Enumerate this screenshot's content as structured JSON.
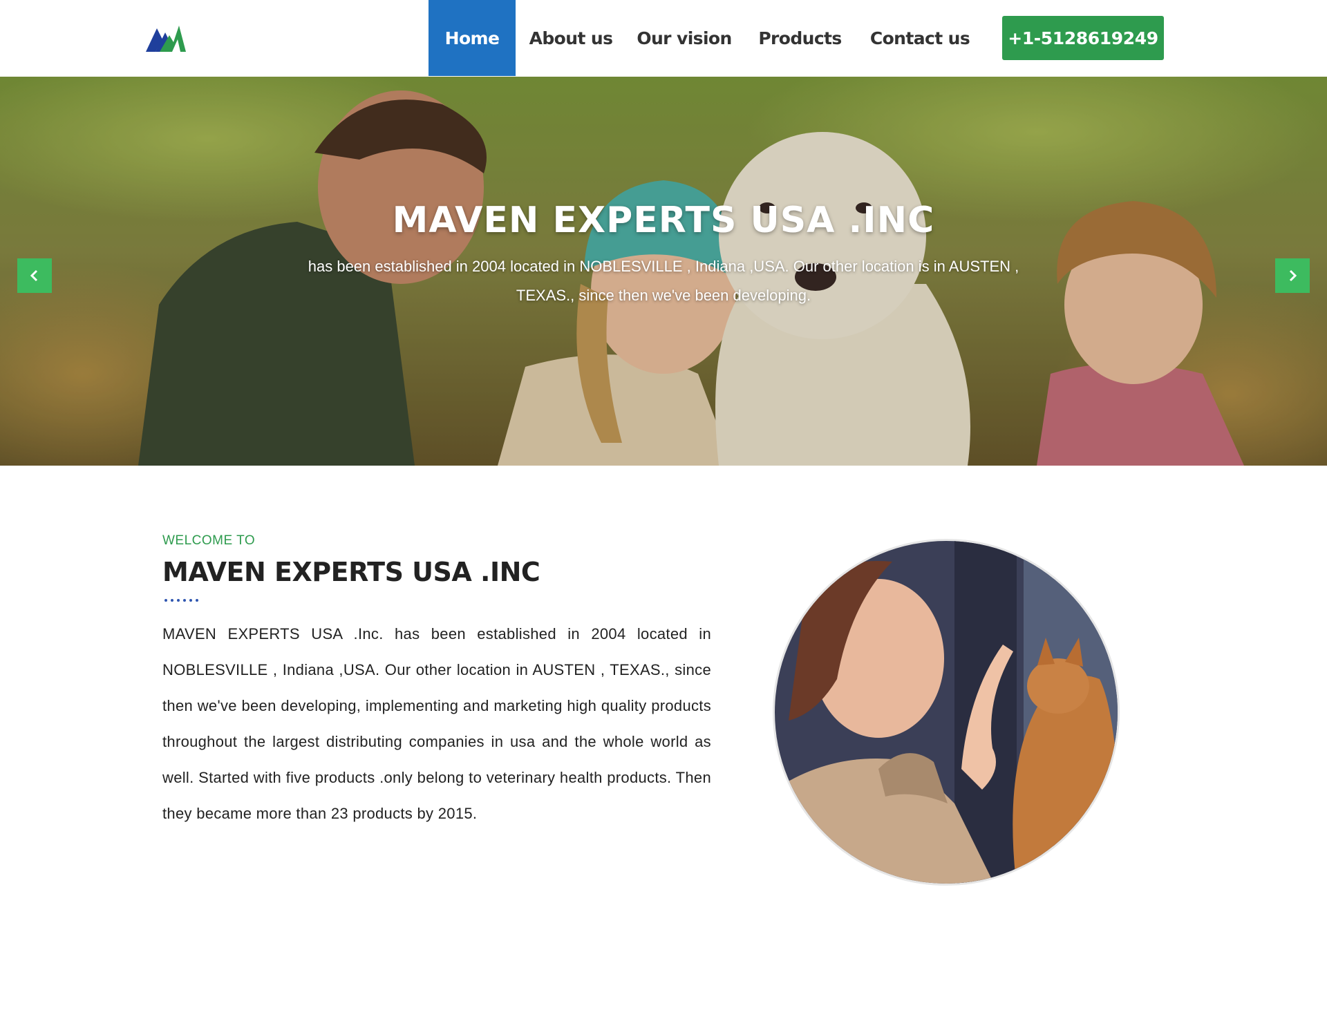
{
  "header": {
    "logo_alt": "Maven Experts logo",
    "nav": [
      {
        "label": "Home",
        "active": true
      },
      {
        "label": "About us",
        "active": false
      },
      {
        "label": "Our vision",
        "active": false
      },
      {
        "label": "Products",
        "active": false
      },
      {
        "label": "Contact us",
        "active": false
      }
    ],
    "phone_label": "+1-5128619249"
  },
  "hero": {
    "title": "MAVEN EXPERTS USA .INC",
    "text": "has been established in 2004 located in NOBLESVILLE , Indiana ,USA. Our other location is in AUSTEN , TEXAS., since then we've been developing.",
    "prev_icon": "chevron-left-icon",
    "next_icon": "chevron-right-icon"
  },
  "welcome": {
    "kicker": "WELCOME TO",
    "title": "MAVEN EXPERTS USA .INC",
    "body": "MAVEN EXPERTS USA .Inc. has been established in 2004 located in NOBLESVILLE , Indiana ,USA. Our other location in AUSTEN , TEXAS., since then we've been developing, implementing and marketing high quality products throughout the largest distributing companies in usa and the whole world as well. Started with five products .only belong to veterinary health products. Then they became more than 23 products by 2015."
  },
  "colors": {
    "nav_active": "#1f72c2",
    "phone_button": "#2e9b4e",
    "slider_arrow": "#3dbb5f",
    "kicker": "#2e9b4e",
    "dots": "#2f56b0"
  }
}
